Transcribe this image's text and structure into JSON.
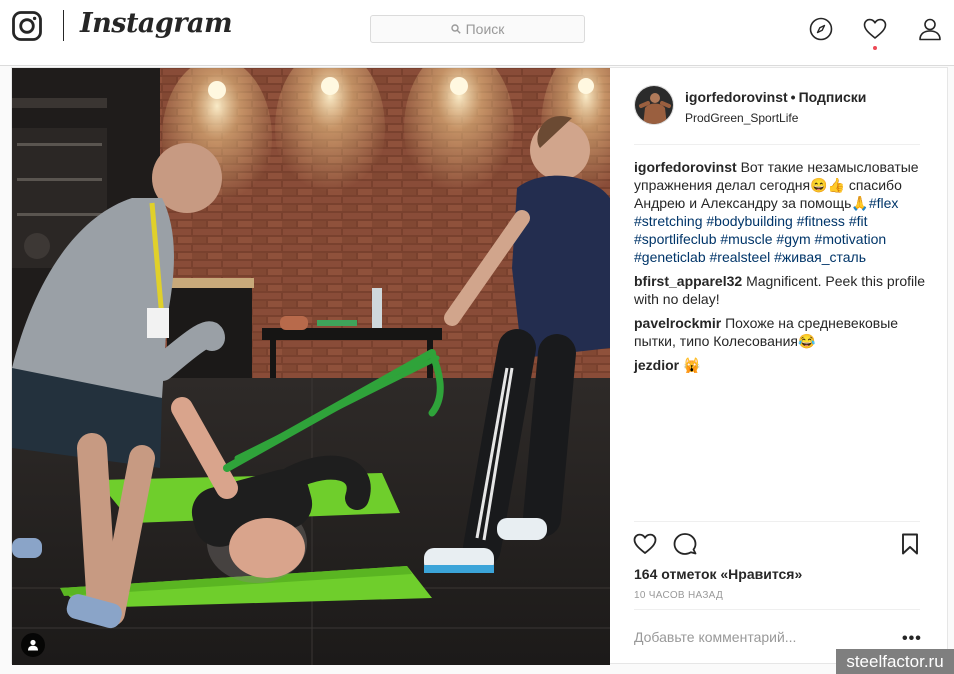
{
  "header": {
    "wordmark": "Instagram",
    "search_placeholder": "Поиск"
  },
  "icons": {
    "logo": "instagram-camera-icon",
    "search": "magnifier-icon",
    "explore": "compass-icon",
    "activity": "heart-icon",
    "profile": "person-icon",
    "like": "heart-outline-icon",
    "comment": "speech-bubble-icon",
    "save": "bookmark-icon",
    "tag": "user-tag-icon"
  },
  "colors": {
    "hashtag": "#003569",
    "notification": "#ed4956",
    "band": "#2fa33a",
    "mat": "#6fce2c"
  },
  "post": {
    "author": "igorfedorovinst",
    "separator": "•",
    "follow_label": "Подписки",
    "location": "ProdGreen_SportLife",
    "caption": {
      "user": "igorfedorovinst",
      "text": "Вот такие незамысловатые упражнения делал сегодня😄👍 спасибо Андрею и Александру за помощь🙏",
      "hashtags": [
        "#flex",
        "#stretching",
        "#bodybuilding",
        "#fitness",
        "#fit",
        "#sportlifeclub",
        "#muscle",
        "#gym",
        "#motivation",
        "#geneticlab",
        "#realsteel",
        "#живая_сталь"
      ]
    },
    "comments": [
      {
        "user": "bfirst_apparel32",
        "text": "Magnificent. Peek this profile with no delay!"
      },
      {
        "user": "pavelrockmir",
        "text": "Похоже на средневековые пытки, типо Колесования😂"
      },
      {
        "user": "jezdior",
        "text": "🙀"
      }
    ],
    "likes": "164 отметок «Нравится»",
    "time_ago": "10 ЧАСОВ НАЗАД",
    "add_comment_placeholder": "Добавьте комментарий...",
    "more_options": "•••"
  },
  "watermark": "steelfactor.ru"
}
